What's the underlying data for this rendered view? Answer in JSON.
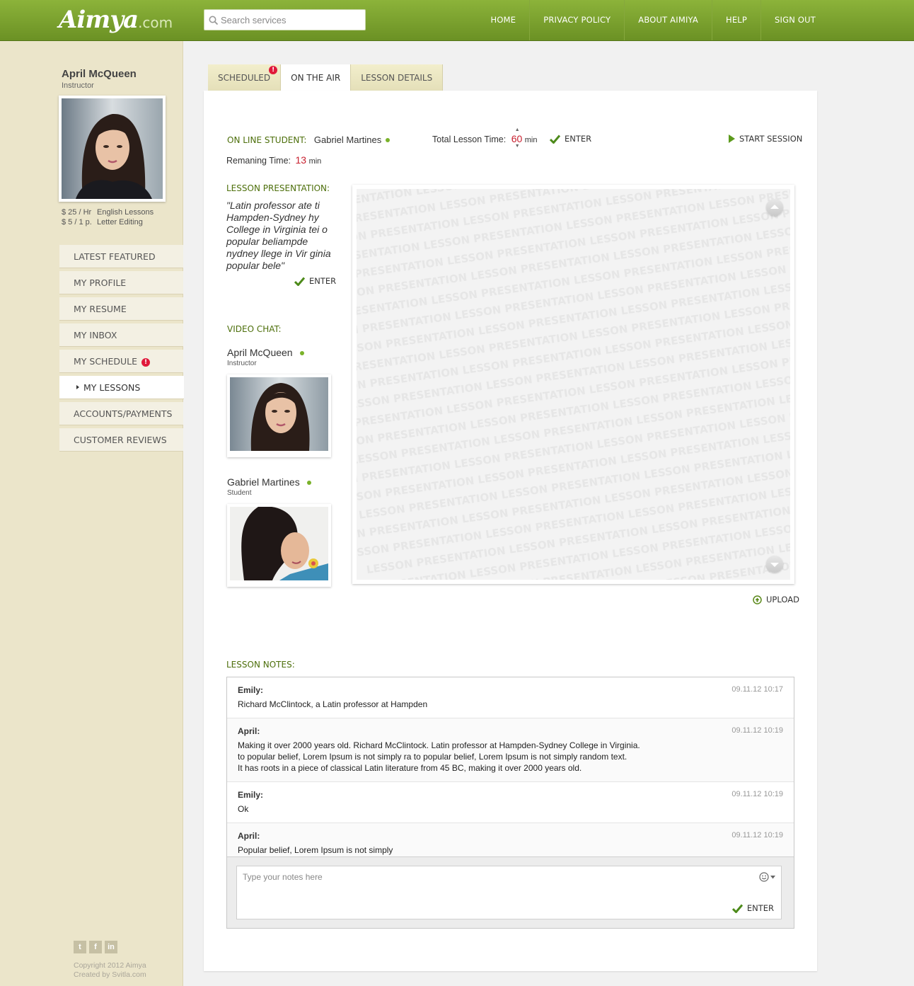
{
  "header": {
    "logo": "Aimya",
    "logo_suffix": ".com",
    "search_placeholder": "Search services",
    "nav": [
      "HOME",
      "PRIVACY POLICY",
      "ABOUT AIMIYA",
      "HELP",
      "SIGN OUT"
    ]
  },
  "sidebar": {
    "name": "April McQueen",
    "role": "Instructor",
    "rates": [
      {
        "price": "$ 25 / Hr",
        "service": "English Lessons"
      },
      {
        "price": "$ 5 / 1 p.",
        "service": "Letter Editing"
      }
    ],
    "menu": [
      {
        "label": "LATEST FEATURED"
      },
      {
        "label": "MY PROFILE"
      },
      {
        "label": "MY RESUME"
      },
      {
        "label": "MY INBOX"
      },
      {
        "label": "MY SCHEDULE",
        "badge": "!"
      },
      {
        "label": "MY LESSONS",
        "active": true
      },
      {
        "label": "ACCOUNTS/PAYMENTS"
      },
      {
        "label": "CUSTOMER REVIEWS"
      }
    ],
    "social_icons": [
      "twitter-icon",
      "facebook-icon",
      "linkedin-icon"
    ],
    "copyright": "Copyright 2012 Aimya",
    "created_by": "Created by Svitla.com"
  },
  "tabs": [
    {
      "label": "SCHEDULED",
      "badge": "!"
    },
    {
      "label": "ON THE AIR",
      "active": true
    },
    {
      "label": "LESSON DETAILS"
    }
  ],
  "session": {
    "online_student_label": "ON LINE STUDENT:",
    "online_student": "Gabriel Martines",
    "total_time_label": "Total Lesson Time:",
    "total_time_value": "60",
    "total_time_unit": "min",
    "enter_label": "ENTER",
    "start_session_label": "START SESSION",
    "remaining_label": "Remaning Time:",
    "remaining_value": "13",
    "remaining_unit": "min"
  },
  "presentation": {
    "label": "LESSON PRESENTATION:",
    "quote": "\"Latin professor ate ti Hampden-Sydney hy College in Virginia tei o popular beliampde nydney llege in Vir ginia popular bele\"",
    "enter_label": "ENTER",
    "watermark": "LESSON PRESENTATION",
    "upload_label": "UPLOAD"
  },
  "video_chat": {
    "label": "VIDEO CHAT:",
    "participants": [
      {
        "name": "April McQueen",
        "role": "Instructor"
      },
      {
        "name": "Gabriel Martines",
        "role": "Student"
      }
    ]
  },
  "notes": {
    "label": "LESSON NOTES:",
    "entries": [
      {
        "author": "Emily:",
        "time": "09.11.12 10:17",
        "lines": [
          "Richard McClintock, a Latin professor at Hampden"
        ]
      },
      {
        "author": "April:",
        "time": "09.11.12 10:19",
        "lines": [
          "Making it over 2000 years old. Richard McClintock. Latin professor at Hampden-Sydney College in Virginia.",
          "to popular belief, Lorem Ipsum is not simply ra to popular belief, Lorem Ipsum is not simply random text.",
          "It has roots in a piece of classical Latin literature from 45 BC, making it over 2000 years old."
        ]
      },
      {
        "author": "Emily:",
        "time": "09.11.12 10:19",
        "lines": [
          "Ok"
        ]
      },
      {
        "author": "April:",
        "time": "09.11.12 10:19",
        "lines": [
          "Popular belief, Lorem Ipsum is not simply"
        ]
      }
    ],
    "input_placeholder": "Type your notes here",
    "enter_label": "ENTER"
  },
  "colors": {
    "header_green": "#7aa22e",
    "label_green": "#4d6f0b",
    "badge_red": "#e0193a",
    "time_red": "#c8202f",
    "sidebar_bg": "#ebe5ca"
  }
}
